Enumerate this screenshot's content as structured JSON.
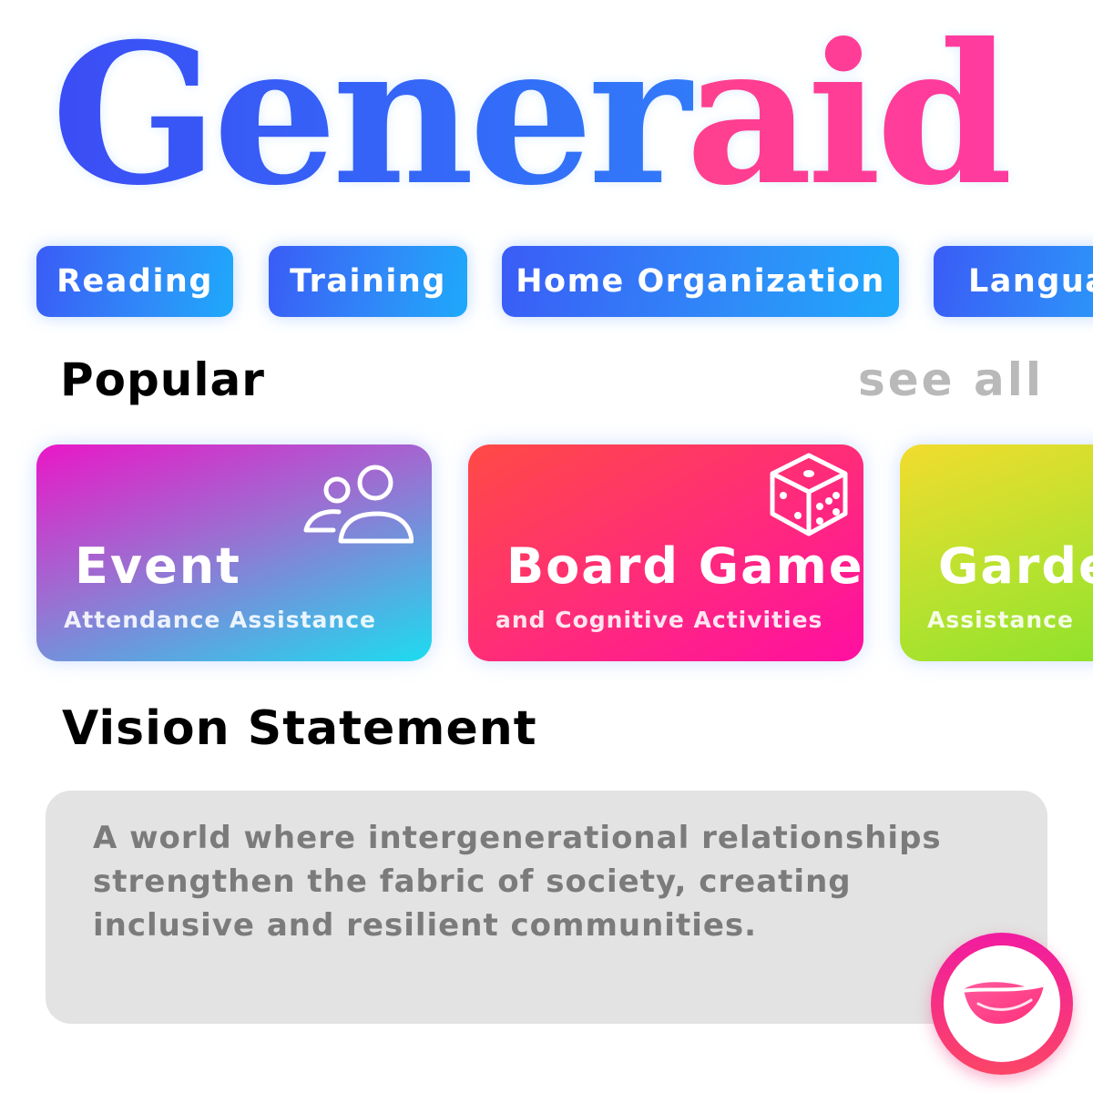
{
  "logo": {
    "part1": "Gener",
    "part2": "aid",
    "colors": {
      "blue_start": "#3b4df5",
      "blue_end": "#2a90fb",
      "pink_start": "#ff4a6a",
      "pink_end": "#ff3aa0"
    }
  },
  "categories": [
    {
      "label": "Reading"
    },
    {
      "label": "Training"
    },
    {
      "label": "Home Organization"
    },
    {
      "label": "Language"
    }
  ],
  "popular": {
    "title": "Popular",
    "see_all": "see all",
    "cards": [
      {
        "title": "Event",
        "subtitle": "Attendance Assistance",
        "icon": "people-icon",
        "colors": [
          "#ea17c7",
          "#1cdcf0"
        ]
      },
      {
        "title": "Board Games",
        "subtitle": "and Cognitive Activities",
        "icon": "dice-icon",
        "colors": [
          "#ff4a45",
          "#ff0fa2"
        ]
      },
      {
        "title": "Gardening",
        "subtitle": "Assistance",
        "icon": "",
        "colors": [
          "#f2dc2e",
          "#78e12a"
        ]
      }
    ]
  },
  "vision": {
    "title": "Vision Statement",
    "text": "A world where intergenerational relationships strengthen the fabric of society, creating inclusive and resilient communities."
  },
  "fab": {
    "icon": "leaf-icon",
    "colors": [
      "#f11ba0",
      "#fb4566"
    ]
  }
}
